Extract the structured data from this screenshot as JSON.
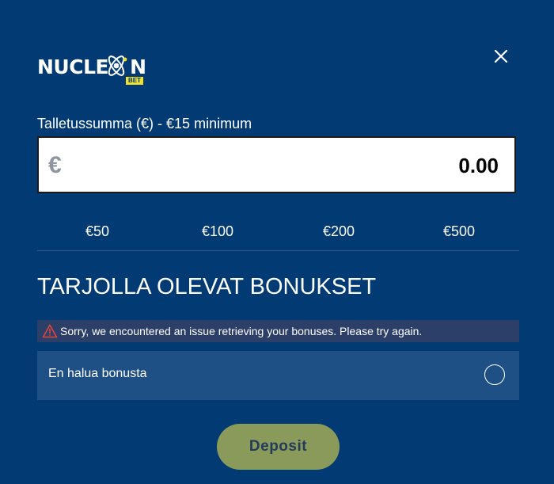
{
  "header": {
    "logo": {
      "text_left": "NUCLE",
      "text_right": "N",
      "badge": "BET"
    },
    "close_icon": "close-icon"
  },
  "deposit": {
    "amount_label": "Talletussumma (€) - €15 minimum",
    "currency_symbol": "€",
    "amount_value": "0.00",
    "presets": [
      "€50",
      "€100",
      "€200",
      "€500"
    ]
  },
  "bonuses": {
    "heading": "TARJOLLA OLEVAT BONUKSET",
    "error_message": "Sorry, we encountered an issue retrieving your bonuses. Please try again.",
    "no_bonus_label": "En halua bonusta"
  },
  "actions": {
    "deposit_label": "Deposit"
  },
  "colors": {
    "background": "#023a73",
    "row_background": "#1e4f85",
    "error_background": "#2b3f68",
    "deposit_button": "#8a9a5a",
    "logo_badge": "#f1e12c",
    "warning_icon": "#e0473c"
  }
}
